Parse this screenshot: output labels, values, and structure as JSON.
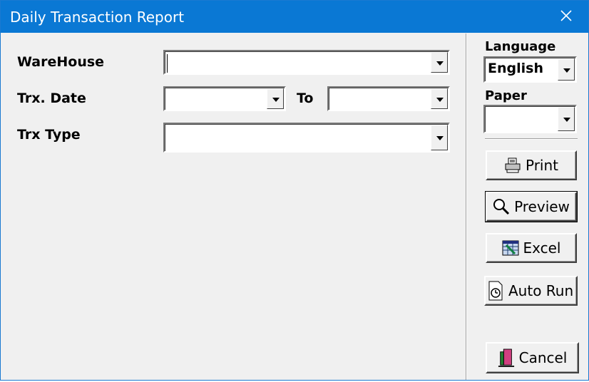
{
  "window": {
    "title": "Daily Transaction Report"
  },
  "form": {
    "warehouse_label": "WareHouse",
    "warehouse_value": "",
    "trx_date_label": "Trx. Date",
    "trx_date_from": "",
    "to_label": "To",
    "trx_date_to": "",
    "trx_type_label": "Trx Type",
    "trx_type_value": ""
  },
  "side": {
    "language_label": "Language",
    "language_value": "English",
    "paper_label": "Paper",
    "paper_value": ""
  },
  "buttons": {
    "print": "Print",
    "preview": "Preview",
    "excel": "Excel",
    "auto_run": "Auto Run",
    "cancel": "Cancel"
  },
  "icons": {
    "close": "close-icon",
    "print": "printer-icon",
    "preview": "magnifier-icon",
    "excel": "spreadsheet-icon",
    "auto_run": "clock-document-icon",
    "cancel": "door-exit-icon"
  }
}
